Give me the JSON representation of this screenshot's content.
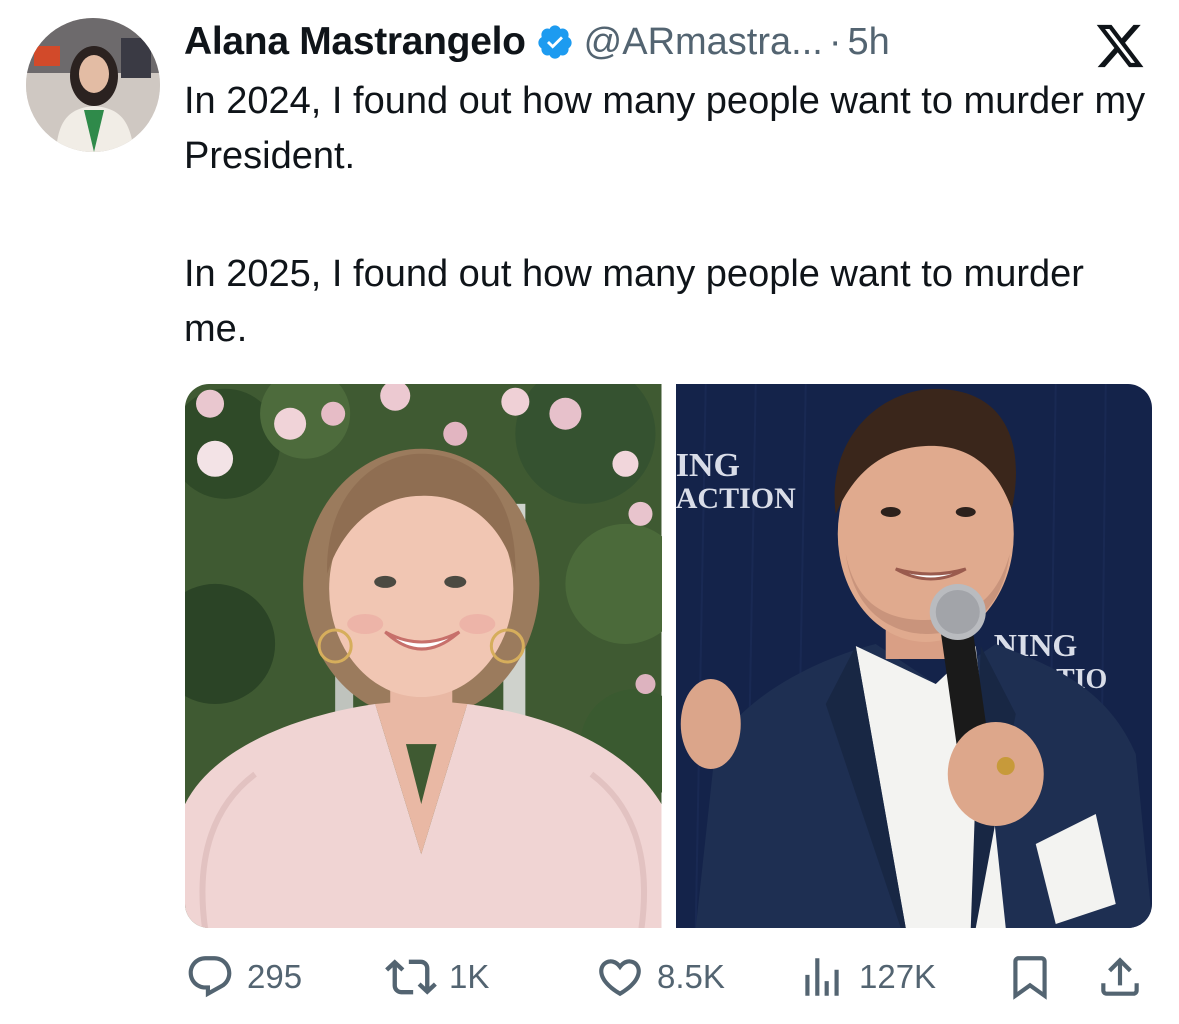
{
  "author": {
    "display_name": "Alana Mastrangelo",
    "handle": "@ARmastra...",
    "separator": "·",
    "time": "5h",
    "verified_icon": "verified-badge-icon",
    "avatar_icon": "avatar"
  },
  "platform": {
    "logo_icon": "x-logo-icon"
  },
  "tweet": {
    "paragraphs": [
      "In 2024, I found out how many people want to murder my President.",
      "In 2025, I found out how many people want to murder me."
    ]
  },
  "media": {
    "image1_overlay": "",
    "image2_banner_top_line1": "ING",
    "image2_banner_top_line2": "ACTION",
    "image2_banner_right_line1": "NING",
    "image2_banner_right_line2": "CTIO"
  },
  "actions": {
    "reply": {
      "icon": "reply-icon",
      "count": "295"
    },
    "retweet": {
      "icon": "retweet-icon",
      "count": "1K"
    },
    "like": {
      "icon": "heart-icon",
      "count": "8.5K"
    },
    "views": {
      "icon": "views-icon",
      "count": "127K"
    },
    "bookmark": {
      "icon": "bookmark-icon"
    },
    "share": {
      "icon": "share-icon"
    }
  },
  "colors": {
    "text_primary": "#0f1419",
    "text_secondary": "#536471",
    "verified_blue": "#1d9bf0"
  }
}
